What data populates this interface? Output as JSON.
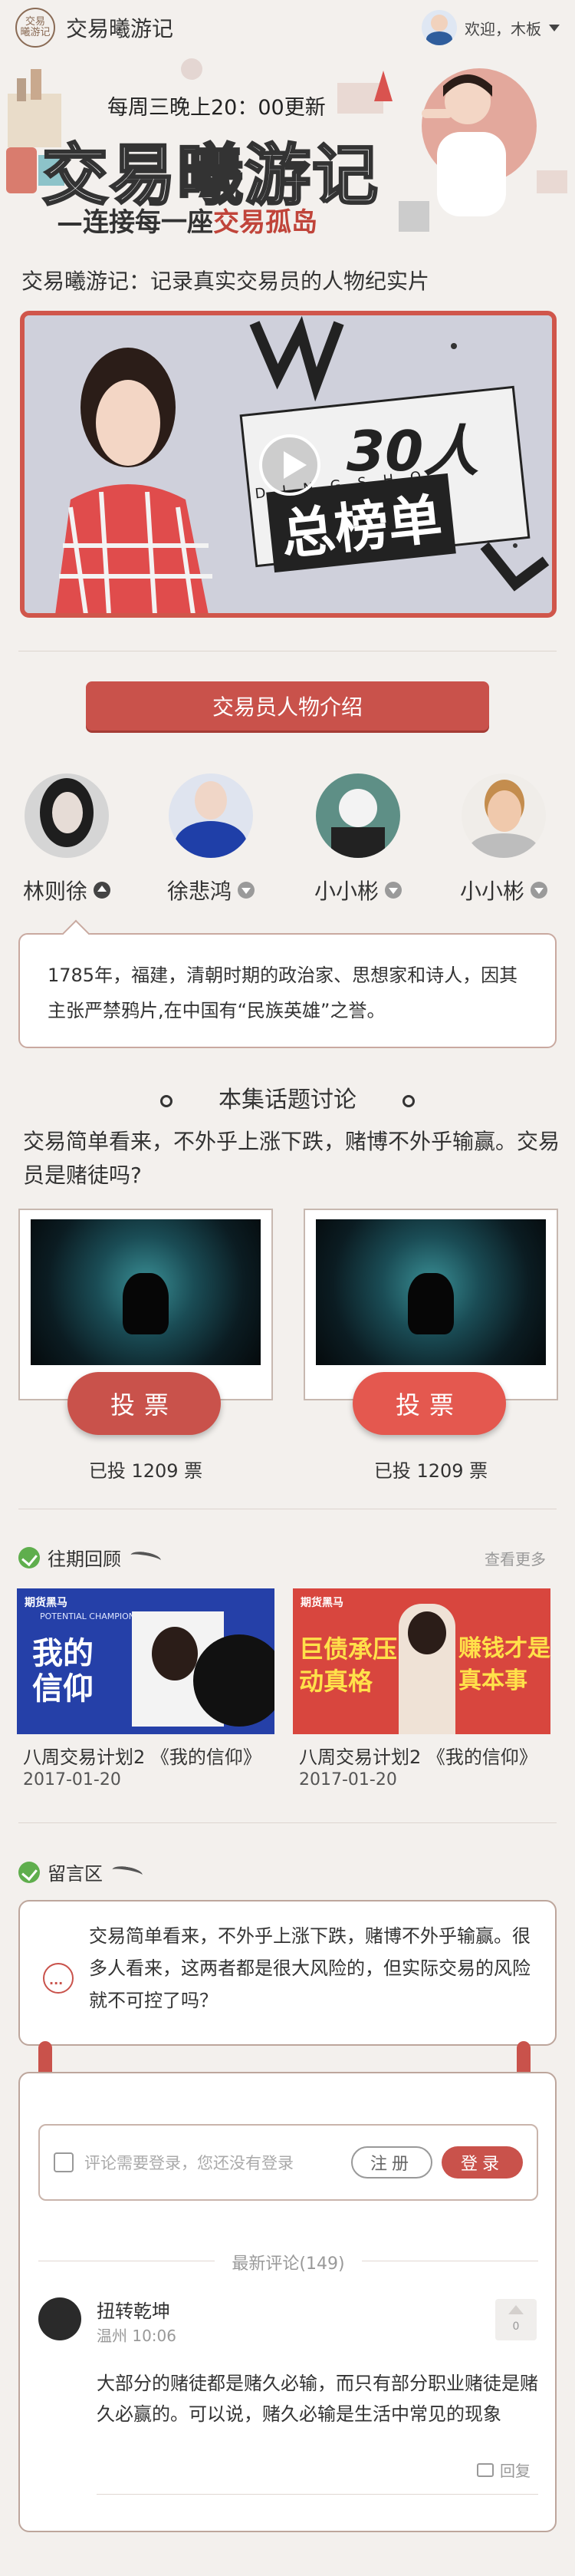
{
  "header": {
    "logo_text": "交易\n曦游记",
    "brand": "交易曦游记",
    "welcome": "欢迎，木板"
  },
  "banner": {
    "update": "每周三晚上20：00更新",
    "title": "交易曦游记",
    "subtitle_a": "—连接每一座",
    "subtitle_b": "交易孤岛"
  },
  "intro": "交易曦游记：记录真实交易员的人物纪实片",
  "video": {
    "sign_big": "30人",
    "sign_small": "总榜单",
    "letters": "DINGSHO"
  },
  "people_button": "交易员人物介绍",
  "people": [
    {
      "name": "林则徐",
      "expanded": true
    },
    {
      "name": "徐悲鸿",
      "expanded": false
    },
    {
      "name": "小小彬",
      "expanded": false
    },
    {
      "name": "小小彬",
      "expanded": false
    }
  ],
  "bio": "1785年，福建，清朝时期的政治家、思想家和诗人，因其主张严禁鸦片,在中国有“民族英雄”之誉。",
  "topic": {
    "heading": "本集话题讨论",
    "question": "交易简单看来，不外乎上涨下跌，赌博不外乎输赢。交易员是赌徒吗?"
  },
  "votes": [
    {
      "button": "投票",
      "count": "已投 1209 票"
    },
    {
      "button": "投票",
      "count": "已投 1209 票"
    }
  ],
  "past": {
    "heading": "往期回顾",
    "more": "查看更多",
    "items": [
      {
        "title": "八周交易计划2 《我的信仰》",
        "date": "2017-01-20",
        "thumb_text": "我的\n信仰",
        "brand": "期货黑马",
        "tag": "POTENTIAL CHAMPION"
      },
      {
        "title": "八周交易计划2 《我的信仰》",
        "date": "2017-01-20",
        "thumb_text_a": "巨债承压\n动真格",
        "thumb_text_b": "赚钱才是\n真本事",
        "brand": "期货黑马"
      }
    ]
  },
  "comments": {
    "heading": "留言区",
    "post": "交易简单看来，不外乎上涨下跌，赌博不外乎输赢。很多人看来，这两者都是很大风险的，但实际交易的风险就不可控了吗？",
    "input_placeholder": "评论需要登录，您还没有登录",
    "register": "注册",
    "login": "登录",
    "latest": "最新评论(149)",
    "items": [
      {
        "name": "扭转乾坤",
        "meta": "温州 10:06",
        "likes": "0",
        "text": "大部分的赌徒都是赌久必输，而只有部分职业赌徒是赌久必赢的。可以说，赌久必输是生活中常见的现象",
        "reply": "回复"
      }
    ]
  },
  "colors": {
    "accent": "#c9524b",
    "bg": "#f3f0ed"
  }
}
